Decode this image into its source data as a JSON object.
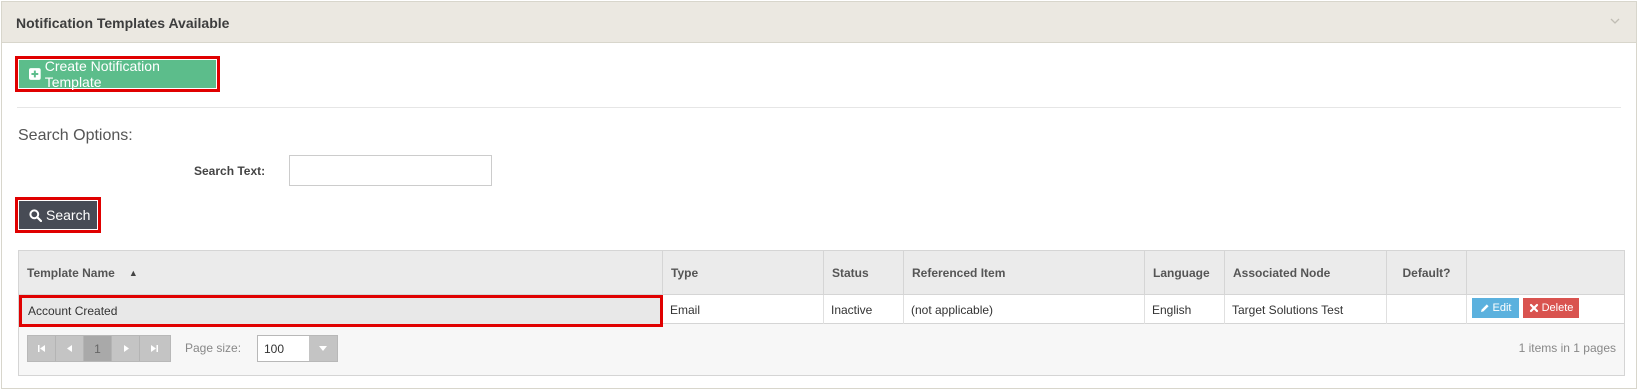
{
  "panel": {
    "title": "Notification Templates Available",
    "collapse_icon": "chevron-down-icon"
  },
  "toolbar": {
    "create_label": "Create Notification Template",
    "create_icon": "plus-square-icon",
    "create_color": "#5cbd8b"
  },
  "search": {
    "options_heading": "Search Options:",
    "text_label": "Search Text:",
    "text_value": "",
    "button_label": "Search",
    "button_icon": "search-icon",
    "button_color": "#474b55"
  },
  "grid": {
    "columns": [
      {
        "label": "Template Name",
        "sorted": "ascending"
      },
      {
        "label": "Type"
      },
      {
        "label": "Status"
      },
      {
        "label": "Referenced Item"
      },
      {
        "label": "Language"
      },
      {
        "label": "Associated Node"
      },
      {
        "label": "Default?"
      },
      {
        "label": ""
      }
    ],
    "rows": [
      {
        "template_name": "Account Created",
        "type": "Email",
        "status": "Inactive",
        "referenced_item": "(not applicable)",
        "language": "English",
        "associated_node": "Target Solutions Test",
        "default": "",
        "edit_label": "Edit",
        "delete_label": "Delete"
      }
    ]
  },
  "pager": {
    "current_page": "1",
    "page_size_label": "Page size:",
    "page_size_value": "100",
    "info": "1 items in 1 pages"
  },
  "colors": {
    "highlight": "#e00000",
    "edit": "#5bb1de",
    "delete": "#d9534f"
  }
}
